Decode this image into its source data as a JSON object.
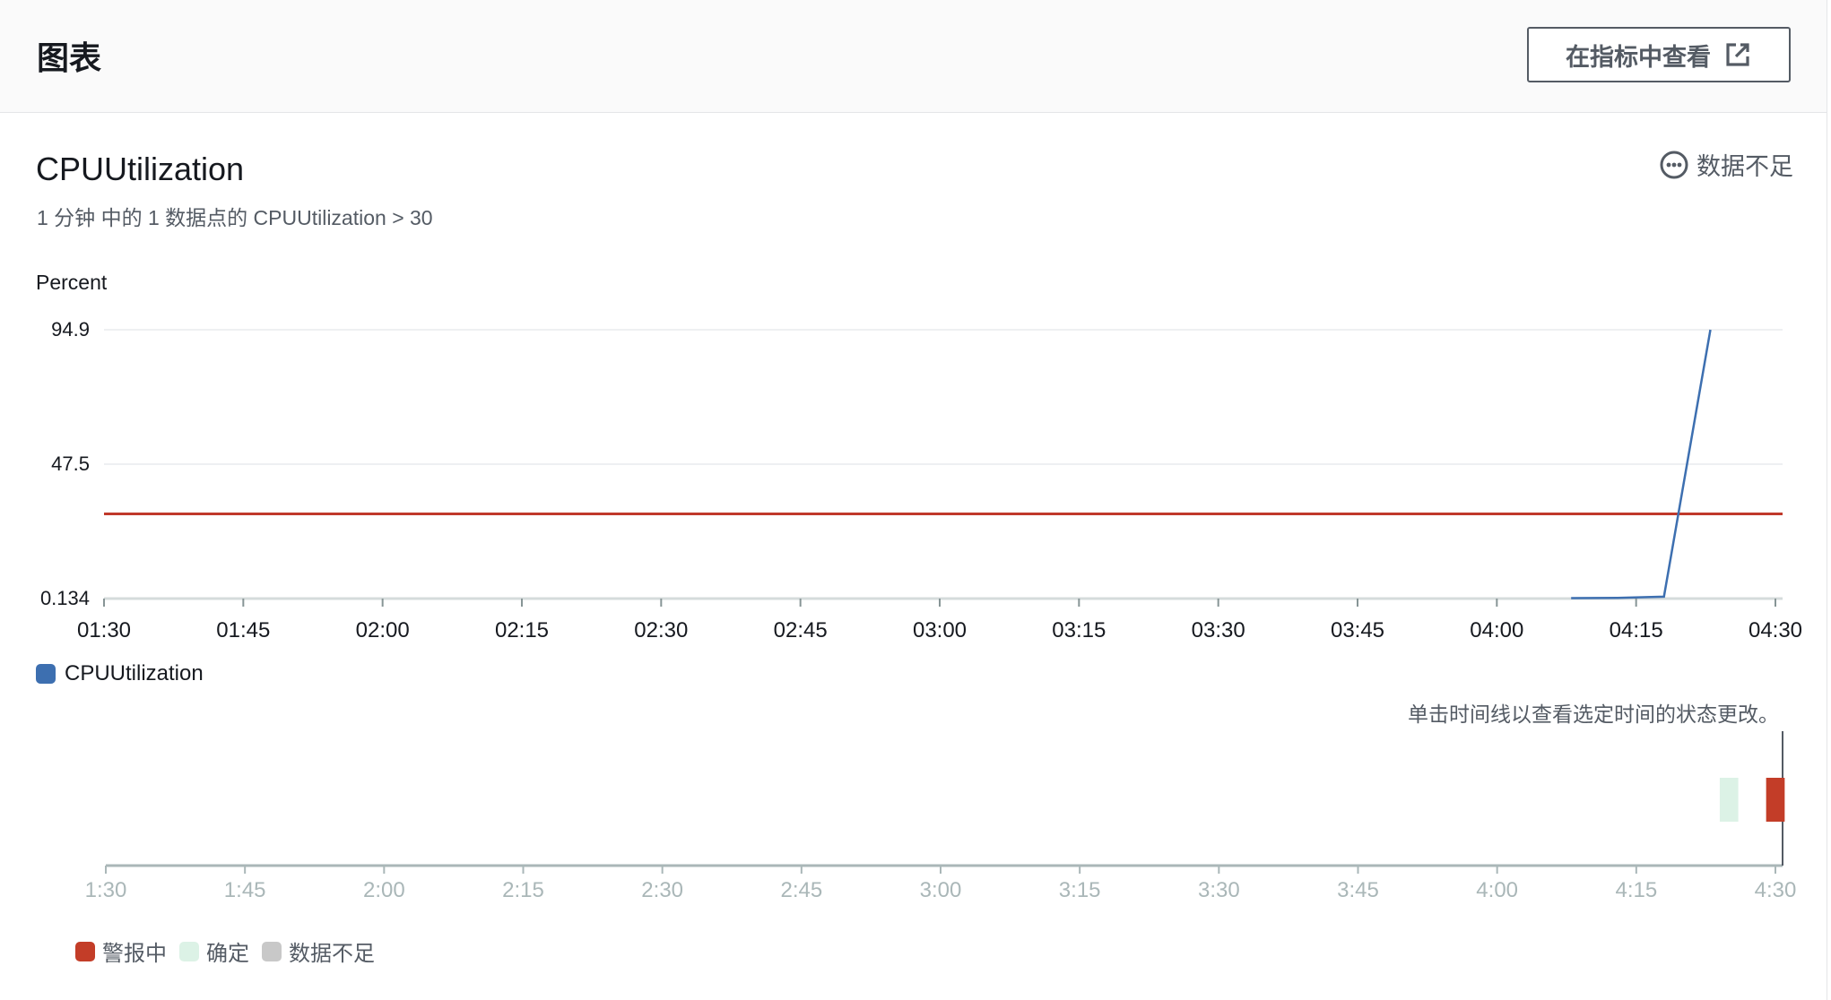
{
  "header": {
    "title": "图表",
    "view_in_metrics_label": "在指标中查看"
  },
  "chart": {
    "metric_title": "CPUUtilization",
    "subtitle": "1 分钟 中的 1 数据点的 CPUUtilization > 30",
    "state_label": "数据不足",
    "y_unit_label": "Percent",
    "legend_label": "CPUUtilization"
  },
  "timeline": {
    "hint": "单击时间线以查看选定时间的状态更改。",
    "legend": {
      "alarm": "警报中",
      "ok": "确定",
      "insufficient": "数据不足"
    }
  },
  "colors": {
    "series": "#3d6fb0",
    "threshold": "#c0392b",
    "alarm": "#c33d28",
    "ok": "#dcf2e6",
    "insufficient": "#c8c8c8"
  },
  "chart_data": [
    {
      "type": "line",
      "title": "CPUUtilization",
      "ylabel": "Percent",
      "xlabel": "",
      "x_ticks": [
        "01:30",
        "01:45",
        "02:00",
        "02:15",
        "02:30",
        "02:45",
        "03:00",
        "03:15",
        "03:30",
        "03:45",
        "04:00",
        "04:15",
        "04:30"
      ],
      "y_ticks": [
        "94.9",
        "47.5",
        "0.134"
      ],
      "ylim": [
        0.134,
        94.9
      ],
      "xlim": [
        "01:30",
        "04:30"
      ],
      "grid": true,
      "legend_position": "bottom-left",
      "series": [
        {
          "name": "CPUUtilization",
          "points": [
            {
              "x": "04:08",
              "y": 0.3
            },
            {
              "x": "04:13",
              "y": 0.4
            },
            {
              "x": "04:18",
              "y": 0.8
            },
            {
              "x": "04:23",
              "y": 94.9
            }
          ]
        }
      ],
      "threshold": 30
    },
    {
      "type": "bar",
      "title": "",
      "x_ticks": [
        "1:30",
        "1:45",
        "2:00",
        "2:15",
        "2:30",
        "2:45",
        "3:00",
        "3:15",
        "3:30",
        "3:45",
        "4:00",
        "4:15",
        "4:30"
      ],
      "xlim": [
        "1:30",
        "4:30"
      ],
      "segments": [
        {
          "state": "ok",
          "start": "4:24",
          "end": "4:26"
        },
        {
          "state": "alarm",
          "start": "4:29",
          "end": "4:31"
        }
      ]
    }
  ]
}
